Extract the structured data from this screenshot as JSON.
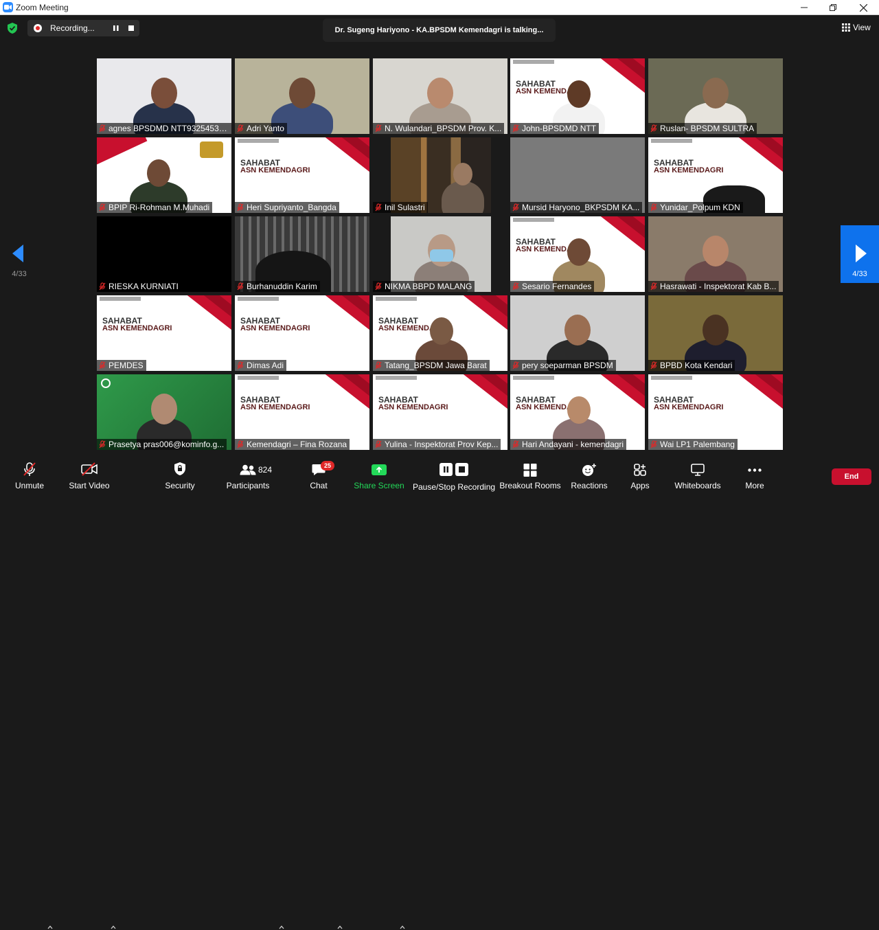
{
  "window": {
    "title": "Zoom Meeting",
    "controls": [
      "minimize",
      "maximize",
      "close"
    ]
  },
  "top": {
    "recording_label": "Recording...",
    "talking": "Dr. Sugeng Hariyono - KA.BPSDM Kemendagri is talking...",
    "view_label": "View"
  },
  "pager": {
    "left": "4/33",
    "right": "4/33"
  },
  "participants": [
    {
      "name": "agnes BPSDMD NTT93254535...",
      "style": "person",
      "bg": "#e9e9ec",
      "skin": "#7a4e3a",
      "shirt": "#27324a"
    },
    {
      "name": "Adri Yanto",
      "style": "person",
      "bg": "#b8b39a",
      "skin": "#6e4a36",
      "shirt": "#3d4e79"
    },
    {
      "name": "N. Wulandari_BPSDM Prov. K...",
      "style": "person",
      "bg": "#d8d6d0",
      "skin": "#b98a6e",
      "shirt": "#a89c90"
    },
    {
      "name": "John-BPSDMD NTT",
      "style": "sahabat-person",
      "skin": "#5e3a26",
      "shirt": "#f2f2f2"
    },
    {
      "name": "Ruslan- BPSDM SULTRA",
      "style": "person",
      "bg": "#6b6a55",
      "skin": "#8a6a50",
      "shirt": "#e8e5df"
    },
    {
      "name": "BPIP Ri-Rohman M.Muhadi",
      "style": "bpip",
      "skin": "#6e4a36",
      "shirt": "#2d3b2a"
    },
    {
      "name": "Heri Supriyanto_Bangda",
      "style": "sahabat"
    },
    {
      "name": "Inil Sulastri",
      "style": "room",
      "skin": "#9a7a62",
      "shirt": "#6a5a4d"
    },
    {
      "name": "Mursid Haryono_BKPSDM KA...",
      "style": "gray"
    },
    {
      "name": "Yunidar_Polpum KDN",
      "style": "sahabat-chair"
    },
    {
      "name": "RIESKA KURNIATI",
      "style": "black"
    },
    {
      "name": "Burhanuddin Karim",
      "style": "dark-window"
    },
    {
      "name": "NIKMA BBPD MALANG",
      "style": "masked",
      "skin": "#b89a86",
      "shirt": "#8c7f78"
    },
    {
      "name": "Sesario Fernandes",
      "style": "sahabat-person",
      "skin": "#6e4a36",
      "shirt": "#a08860"
    },
    {
      "name": "Hasrawati - Inspektorat Kab B...",
      "style": "person",
      "bg": "#8a7b6a",
      "skin": "#b8866a",
      "shirt": "#6a4a4a"
    },
    {
      "name": "PEMDES",
      "style": "sahabat"
    },
    {
      "name": "Dimas Adi",
      "style": "sahabat"
    },
    {
      "name": "Tatang_BPSDM Jawa Barat",
      "style": "sahabat-person",
      "skin": "#7a5a44",
      "shirt": "#6b4a3a"
    },
    {
      "name": "pery soeparman BPSDM",
      "style": "person",
      "bg": "#cfcfcf",
      "skin": "#9a6e52",
      "shirt": "#2a2a2a"
    },
    {
      "name": "BPBD Kota Kendari",
      "style": "person",
      "bg": "#7a6a3a",
      "skin": "#4a3222",
      "shirt": "#1e1e2e"
    },
    {
      "name": "Prasetya pras006@kominfo.g...",
      "style": "green",
      "skin": "#b08a72",
      "shirt": "#2a2a2a"
    },
    {
      "name": "Kemendagri – Fina Rozana",
      "style": "sahabat"
    },
    {
      "name": "Yulina - Inspektorat Prov Kep...",
      "style": "sahabat"
    },
    {
      "name": "Hari Andayani - kemendagri",
      "style": "sahabat-person",
      "skin": "#b88a6a",
      "shirt": "#8a7070"
    },
    {
      "name": "Wai LP1 Palembang",
      "style": "sahabat"
    }
  ],
  "sahabat_text": {
    "title": "SAHABAT",
    "sub": "ASN KEMENDAGRI"
  },
  "toolbar": {
    "unmute": "Unmute",
    "start_video": "Start Video",
    "security": "Security",
    "participants": "Participants",
    "participants_count": "824",
    "chat": "Chat",
    "chat_badge": "25",
    "share_screen": "Share Screen",
    "pause_stop": "Pause/Stop Recording",
    "breakout": "Breakout Rooms",
    "reactions": "Reactions",
    "apps": "Apps",
    "whiteboards": "Whiteboards",
    "more": "More",
    "end": "End"
  },
  "colors": {
    "accent_blue": "#0e72ed",
    "share_green": "#23d959",
    "end_red": "#c8102e",
    "muted_red": "#e02828"
  }
}
